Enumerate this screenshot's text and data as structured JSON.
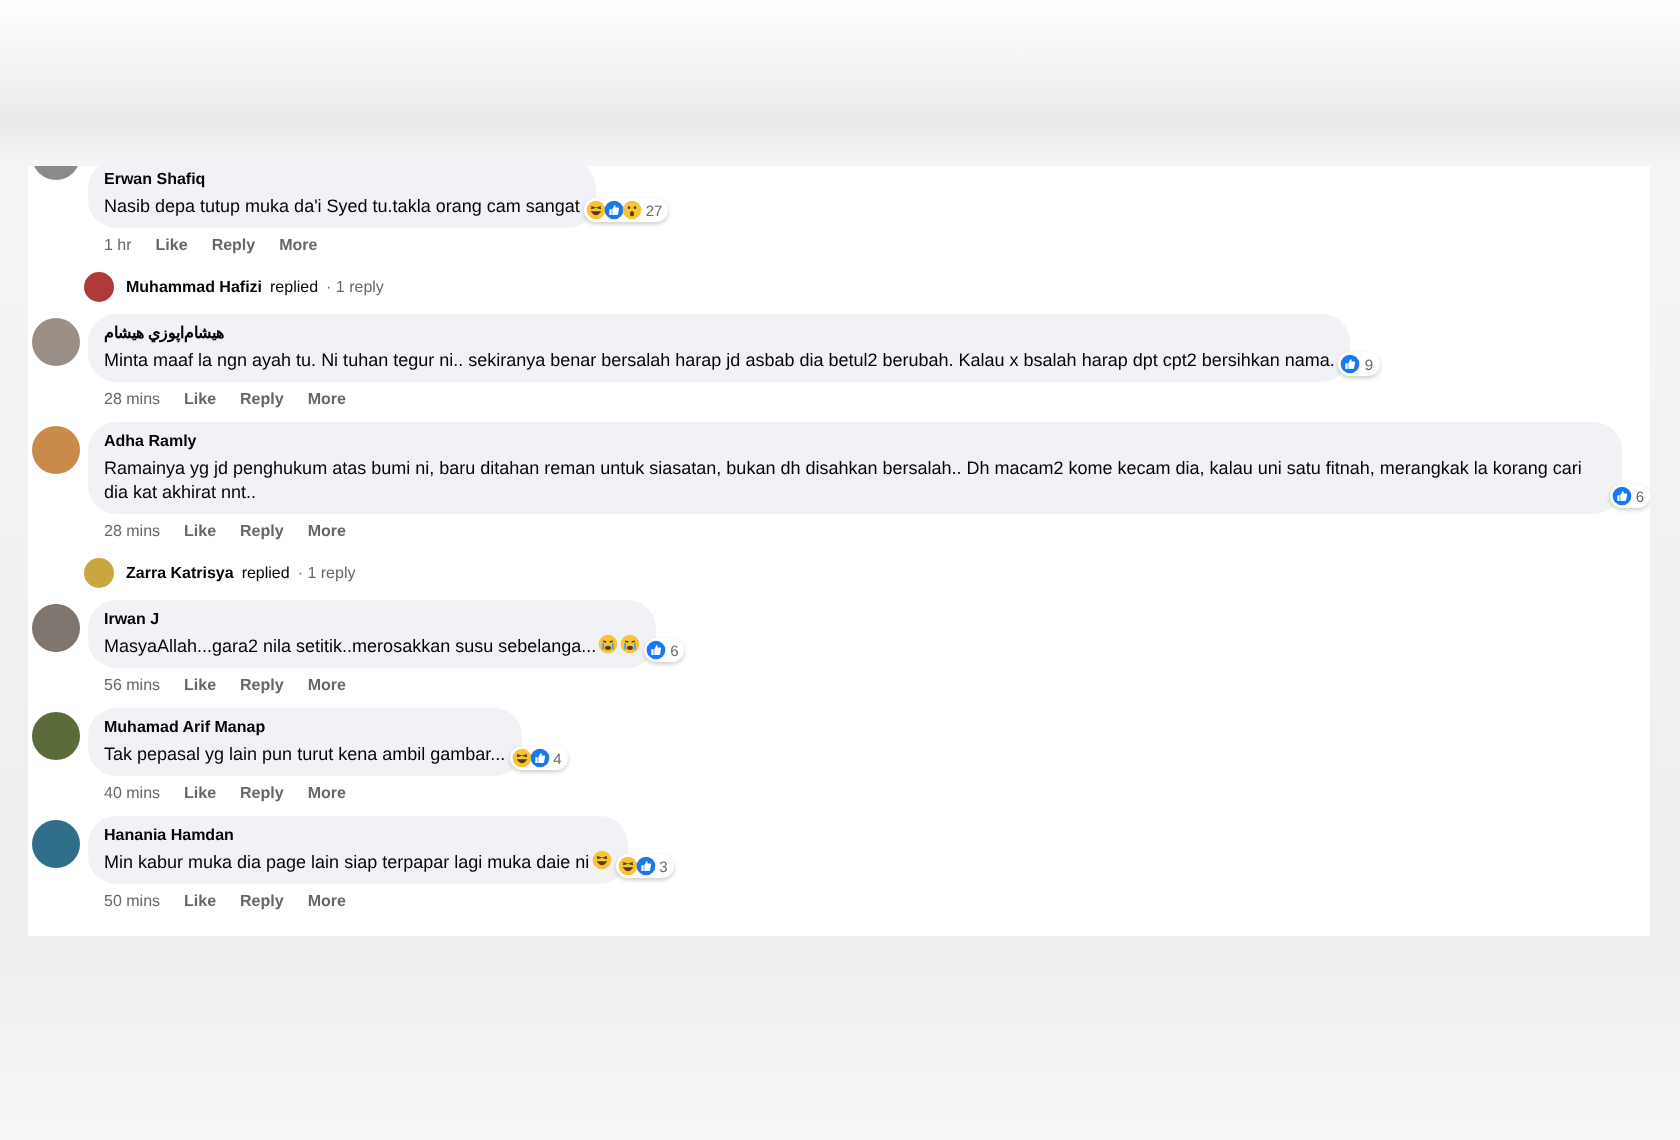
{
  "comments": [
    {
      "kind": "comment",
      "author": "Erwan Shafiq",
      "text": "Nasib depa tutup muka da'i Syed tu.takla orang cam sangat",
      "reactions": [
        {
          "kind": "haha"
        },
        {
          "kind": "like"
        },
        {
          "kind": "wow"
        }
      ],
      "reaction_count": "27",
      "time": "1 hr",
      "actions": [
        "Like",
        "Reply",
        "More"
      ]
    },
    {
      "kind": "reply_summary",
      "author": "Muhammad Hafizi",
      "verb": "replied",
      "count": "· 1 reply"
    },
    {
      "kind": "comment",
      "author": "هيشام‌اپوزي هيشام",
      "text": "Minta maaf la ngn ayah tu. Ni tuhan tegur ni.. sekiranya benar bersalah harap jd asbab dia betul2 berubah. Kalau x bsalah harap dpt cpt2 bersihkan nama.",
      "reactions": [
        {
          "kind": "like"
        }
      ],
      "reaction_count": "9",
      "time": "28 mins",
      "actions": [
        "Like",
        "Reply",
        "More"
      ]
    },
    {
      "kind": "comment",
      "author": "Adha Ramly",
      "text": "Ramainya yg jd penghukum atas bumi ni, baru ditahan reman untuk siasatan, bukan dh disahkan bersalah.. Dh macam2 kome kecam dia, kalau uni satu fitnah, merangkak la korang cari dia kat akhirat nnt..",
      "reactions": [
        {
          "kind": "like"
        }
      ],
      "reaction_count": "6",
      "time": "28 mins",
      "actions": [
        "Like",
        "Reply",
        "More"
      ]
    },
    {
      "kind": "reply_summary",
      "author": "Zarra Katrisya",
      "verb": "replied",
      "count": "· 1 reply"
    },
    {
      "kind": "comment",
      "author": "Irwan J",
      "text": "MasyaAllah...gara2 nila setitik..merosakkan susu sebelanga...",
      "emojis": [
        {
          "kind": "sad"
        },
        {
          "kind": "sad"
        }
      ],
      "reactions": [
        {
          "kind": "like"
        }
      ],
      "reaction_count": "6",
      "time": "56 mins",
      "actions": [
        "Like",
        "Reply",
        "More"
      ]
    },
    {
      "kind": "comment",
      "author": "Muhamad Arif Manap",
      "text": "Tak pepasal yg lain pun turut kena ambil gambar...",
      "reactions": [
        {
          "kind": "haha"
        },
        {
          "kind": "like"
        }
      ],
      "reaction_count": "4",
      "time": "40 mins",
      "actions": [
        "Like",
        "Reply",
        "More"
      ]
    },
    {
      "kind": "comment",
      "author": "Hanania Hamdan",
      "text": "Min kabur muka dia page lain siap terpapar lagi muka daie ni",
      "emojis": [
        {
          "kind": "haha"
        }
      ],
      "reactions": [
        {
          "kind": "haha"
        },
        {
          "kind": "like"
        }
      ],
      "reaction_count": "3",
      "time": "50 mins",
      "actions": [
        "Like",
        "Reply",
        "More"
      ]
    }
  ]
}
